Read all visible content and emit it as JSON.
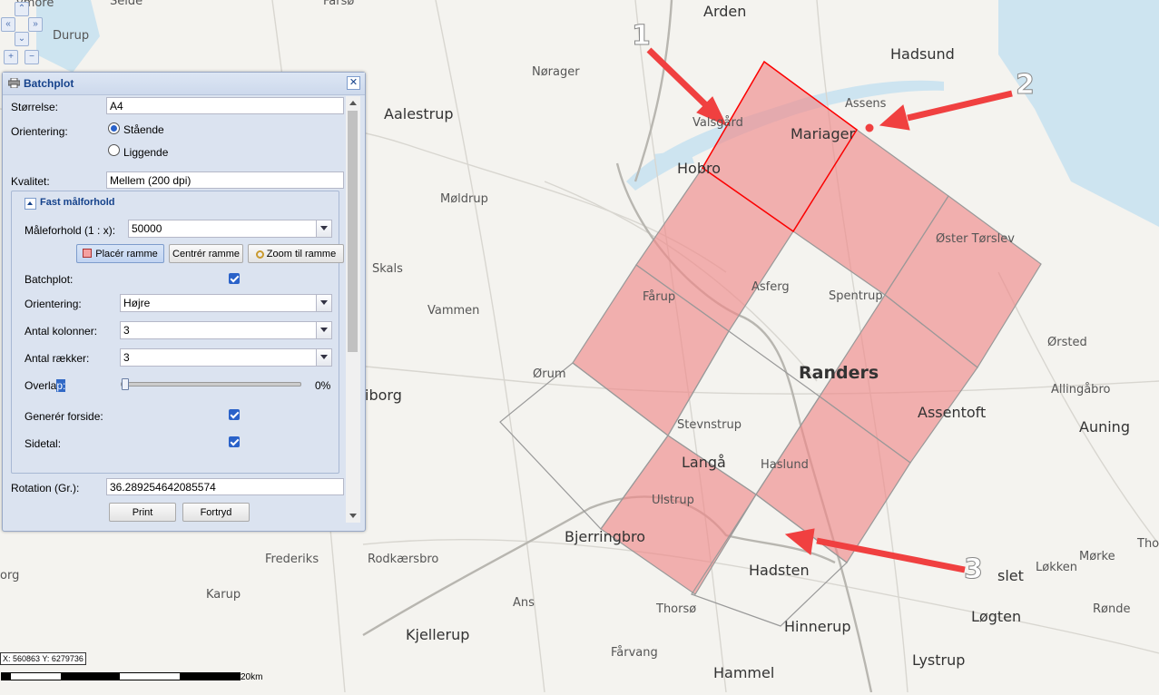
{
  "map": {
    "places": [
      {
        "name": "Arden",
        "cls": "big"
      },
      {
        "name": "Hadsund",
        "cls": "big"
      },
      {
        "name": "Nørager",
        "cls": ""
      },
      {
        "name": "Assens",
        "cls": ""
      },
      {
        "name": "Aalestrup",
        "cls": "big"
      },
      {
        "name": "Valsgård",
        "cls": ""
      },
      {
        "name": "Mariager",
        "cls": "big"
      },
      {
        "name": "Hobro",
        "cls": "big"
      },
      {
        "name": "Durup",
        "cls": ""
      },
      {
        "name": "Møldrup",
        "cls": ""
      },
      {
        "name": "Øster Tørslev",
        "cls": ""
      },
      {
        "name": "Skals",
        "cls": ""
      },
      {
        "name": "Vammen",
        "cls": ""
      },
      {
        "name": "Fårup",
        "cls": ""
      },
      {
        "name": "Asferg",
        "cls": ""
      },
      {
        "name": "Spentrup",
        "cls": ""
      },
      {
        "name": "Ørsted",
        "cls": ""
      },
      {
        "name": "Ørum",
        "cls": ""
      },
      {
        "name": "Randers",
        "cls": "bold"
      },
      {
        "name": "Allingåbro",
        "cls": ""
      },
      {
        "name": "Assentoft",
        "cls": "big"
      },
      {
        "name": "Auning",
        "cls": "big"
      },
      {
        "name": "Stevnstrup",
        "cls": ""
      },
      {
        "name": "Langå",
        "cls": "big"
      },
      {
        "name": "Haslund",
        "cls": ""
      },
      {
        "name": "Ulstrup",
        "cls": ""
      },
      {
        "name": "Bjerringbro",
        "cls": "big"
      },
      {
        "name": "Frederiks",
        "cls": ""
      },
      {
        "name": "Rodkærsbro",
        "cls": ""
      },
      {
        "name": "Hadsten",
        "cls": "big"
      },
      {
        "name": "Løkken",
        "cls": ""
      },
      {
        "name": "Mørke",
        "cls": ""
      },
      {
        "name": "Karup",
        "cls": ""
      },
      {
        "name": "Ans",
        "cls": ""
      },
      {
        "name": "Thorsø",
        "cls": ""
      },
      {
        "name": "Hinnerup",
        "cls": "big"
      },
      {
        "name": "Løgten",
        "cls": "big"
      },
      {
        "name": "Rønde",
        "cls": ""
      },
      {
        "name": "Kjellerup",
        "cls": "big"
      },
      {
        "name": "Fårvang",
        "cls": ""
      },
      {
        "name": "Lystrup",
        "cls": "big"
      },
      {
        "name": "Hammel",
        "cls": "big"
      },
      {
        "name": "Selde",
        "cls": "trunc"
      },
      {
        "name": "Farsø",
        "cls": "trunc"
      },
      {
        "name": "iborg",
        "cls": "big"
      },
      {
        "name": "org",
        "cls": "trunc"
      },
      {
        "name": "slet",
        "cls": "big"
      },
      {
        "name": "Tho",
        "cls": "trunc"
      },
      {
        "name": "ymore",
        "cls": "trunc"
      }
    ],
    "callouts": [
      "1",
      "2",
      "3"
    ],
    "coords": "X: 560863 Y: 6279736",
    "scale": "20km",
    "colors": {
      "selected": "#f08a8a",
      "frame": "#888888",
      "active": "#ff0000",
      "arrow": "#f04040"
    }
  },
  "panel": {
    "title": "Batchplot",
    "size_label": "Størrelse:",
    "size_value": "A4",
    "orientation_label": "Orientering:",
    "orient_portrait": "Stående",
    "orient_landscape": "Liggende",
    "quality_label": "Kvalitet:",
    "quality_value": "Mellem (200 dpi)",
    "fixed_scale_legend": "Fast målforhold",
    "scale_label": "Måleforhold (1 : x):",
    "scale_value": "50000",
    "place_frame": "Placér ramme",
    "center_frame": "Centrér ramme",
    "zoom_frame": "Zoom til ramme",
    "batch_label": "Batchplot:",
    "batch_orient_label": "Orientering:",
    "batch_orient_value": "Højre",
    "cols_label": "Antal kolonner:",
    "cols_value": "3",
    "rows_label": "Antal rækker:",
    "rows_value": "3",
    "overlap_label_a": "Overla",
    "overlap_label_b": "p:",
    "overlap_value": "0%",
    "overlap_fraction": 0,
    "cover_label": "Generér forside:",
    "pagenum_label": "Sidetal:",
    "rotation_label": "Rotation (Gr.):",
    "rotation_value": "36.289254642085574",
    "print": "Print",
    "cancel": "Fortryd"
  }
}
